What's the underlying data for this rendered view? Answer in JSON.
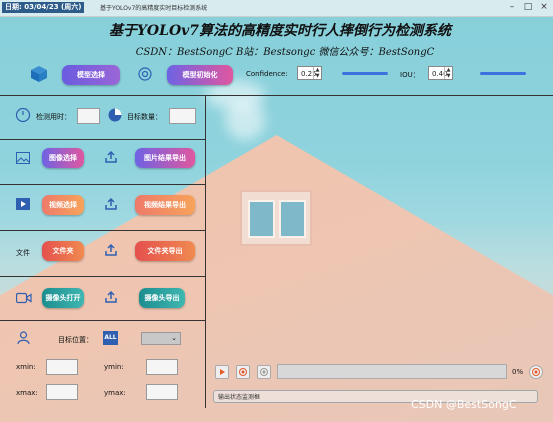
{
  "titlebar": {
    "datetime": "日期: 03/04/23 (周六)",
    "title": "基于YOLOv7的高精度实时目标检测系统"
  },
  "header": {
    "title": "基于YOLOv7算法的高精度实时行人摔倒行为检测系统",
    "subtitle": "CSDN：BestSongC   B站：Bestsongc   微信公众号：BestSongC"
  },
  "toolbar": {
    "model_select": "模型选择",
    "model_init": "模型初始化",
    "confidence_label": "Confidence:",
    "confidence_value": "0.25",
    "iou_label": "IOU：",
    "iou_value": "0.40"
  },
  "stats": {
    "time_label": "检测用时：",
    "count_label": "目标数量："
  },
  "image_row": {
    "select": "图像选择",
    "export": "图片结果导出"
  },
  "video_row": {
    "select": "视频选择",
    "export": "视频结果导出"
  },
  "folder_row": {
    "label": "文件",
    "open": "文件夹",
    "export": "文件夹导出"
  },
  "camera_row": {
    "open": "摄像头打开",
    "export": "摄像头导出"
  },
  "target": {
    "position_label": "目标位置：",
    "all_badge": "ALL",
    "xmin": "xmin:",
    "ymin": "ymin:",
    "xmax": "xmax:",
    "ymax": "ymax:"
  },
  "player": {
    "progress": "0%"
  },
  "status": {
    "text": "输出状态监测框"
  },
  "watermark": "CSDN @BestSongC"
}
